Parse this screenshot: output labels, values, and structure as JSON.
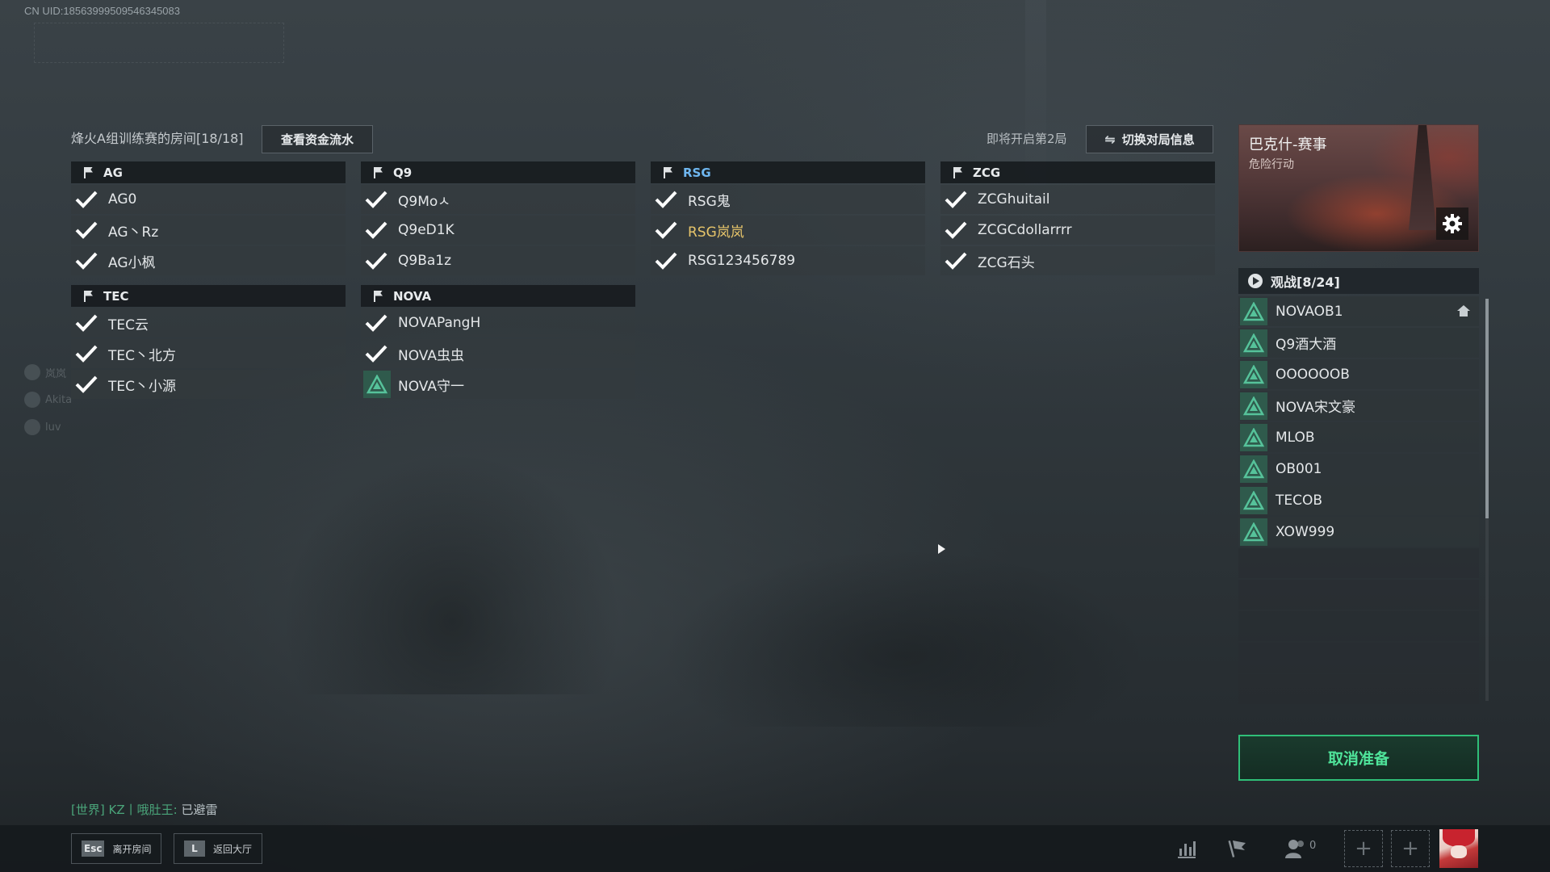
{
  "uid": "CN UID:18563999509546345083",
  "room": {
    "title": "烽火A组训练赛的房间[18/18]",
    "view_funds_label": "查看资金流水",
    "next_round": "即将开启第2局",
    "switch_info_label": "切换对局信息"
  },
  "teams": [
    {
      "name": "AG",
      "players": [
        "AG0",
        "AG丶Rz",
        "AG小枫"
      ]
    },
    {
      "name": "Q9",
      "players": [
        "Q9Moㅅ",
        "Q9eD1K",
        "Q9Ba1z"
      ]
    },
    {
      "name": "RSG",
      "players": [
        "RSG鬼",
        "RSG岚岚",
        "RSG123456789"
      ]
    },
    {
      "name": "ZCG",
      "players": [
        "ZCGhuitail",
        "ZCGCdollarrrr",
        "ZCG石头"
      ]
    },
    {
      "name": "TEC",
      "players": [
        "TEC云",
        "TEC丶北方",
        "TEC丶小源"
      ]
    },
    {
      "name": "NOVA",
      "players": [
        "NOVAPangH",
        "NOVA虫虫",
        "NOVA守一"
      ]
    }
  ],
  "map": {
    "name": "巴克什-赛事",
    "mode": "危险行动"
  },
  "spectators": {
    "header": "观战[8/24]",
    "list": [
      "NOVAOB1",
      "Q9酒大酒",
      "OOOOOOB",
      "NOVA宋文豪",
      "MLOB",
      "OB001",
      "TECOB",
      "XOW999"
    ]
  },
  "cancel_ready_label": "取消准备",
  "chat": {
    "channel": "[世界]",
    "sender": "KZ丨哦肚王:",
    "message": "已避雷"
  },
  "side_friends": [
    "岚岚",
    "Akita",
    "luv"
  ],
  "bottom": {
    "esc_key": "Esc",
    "leave_room": "离开房间",
    "l_key": "L",
    "back_lobby": "返回大厅",
    "friend_count": "0"
  },
  "colors": {
    "ready_check": "#ffffff",
    "triangle_badge": "#2f5a4c",
    "cancel_green": "#2fbf78",
    "highlight_team": "#6fb7f0",
    "highlight_player": "#e6c46a"
  }
}
